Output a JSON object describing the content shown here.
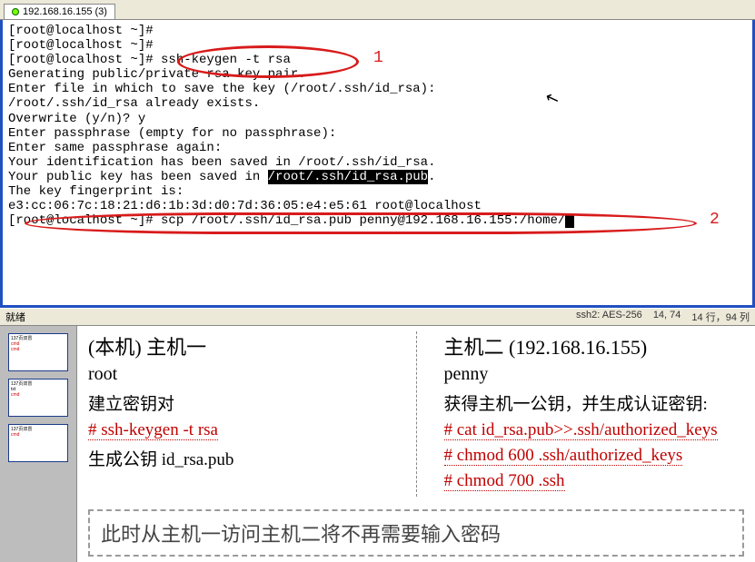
{
  "tab": {
    "title": "192.168.16.155 (3)"
  },
  "terminal": {
    "lines": [
      "[root@localhost ~]#",
      "[root@localhost ~]#",
      "[root@localhost ~]# ssh-keygen -t rsa",
      "Generating public/private rsa key pair.",
      "Enter file in which to save the key (/root/.ssh/id_rsa):",
      "/root/.ssh/id_rsa already exists.",
      "Overwrite (y/n)? y",
      "Enter passphrase (empty for no passphrase):",
      "Enter same passphrase again:",
      "Your identification has been saved in /root/.ssh/id_rsa.",
      "Your public key has been saved in ",
      "/root/.ssh/id_rsa.pub",
      ".",
      "The key fingerprint is:",
      "e3:cc:06:7c:18:21:d6:1b:3d:d0:7d:36:05:e4:e5:61 root@localhost",
      "[root@localhost ~]# scp /root/.ssh/id_rsa.pub penny@192.168.16.155:/home/"
    ]
  },
  "annotations": {
    "label1": "1",
    "label2": "2"
  },
  "statusbar": {
    "left": "就绪",
    "ssh": "ssh2: AES-256",
    "pos": "14, 74",
    "size": "14 行，94 列"
  },
  "slide": {
    "left": {
      "title": "(本机) 主机一",
      "user": "root",
      "step1": "建立密钥对",
      "cmd1": "# ssh-keygen -t rsa",
      "step2": "生成公钥 id_rsa.pub"
    },
    "right": {
      "title": "主机二 (192.168.16.155)",
      "user": "penny",
      "step1": "获得主机一公钥，并生成认证密钥:",
      "cmd1": "# cat id_rsa.pub>>.ssh/authorized_keys",
      "cmd2": "# chmod 600 .ssh/authorized_keys",
      "cmd3": "# chmod 700 .ssh"
    },
    "note": "此时从主机一访问主机二将不再需要输入密码"
  },
  "thumbs": {
    "t1": "137页双冒",
    "t2": "137页双冒",
    "t3": "137页双冒"
  }
}
